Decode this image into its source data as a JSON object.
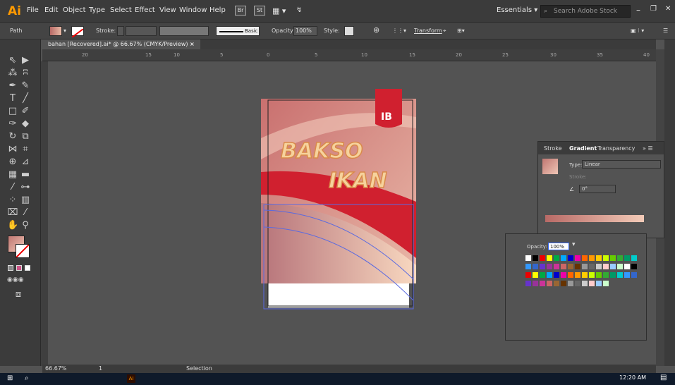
{
  "app": {
    "logo": "Ai"
  },
  "menu": [
    "File",
    "Edit",
    "Object",
    "Type",
    "Select",
    "Effect",
    "View",
    "Window",
    "Help"
  ],
  "badges": [
    "Br",
    "St"
  ],
  "workspace": "Essentials",
  "search_placeholder": "Search Adobe Stock",
  "control": {
    "selection": "Path",
    "stroke_label": "Stroke:",
    "brush": "Basic",
    "opacity_label": "Opacity:",
    "opacity_value": "100%",
    "style_label": "Style:",
    "transform_label": "Transform"
  },
  "document_tab": {
    "title": "bahan [Recovered].ai* @ 66.67% (CMYK/Preview)",
    "close": "×"
  },
  "ruler": [
    "20",
    "15",
    "10",
    "5",
    "0",
    "5",
    "10",
    "15",
    "20",
    "25",
    "30",
    "35",
    "40"
  ],
  "artwork": {
    "tag": "IB",
    "line1": "BAKSO",
    "line2": "IKAN"
  },
  "gradient_panel": {
    "tabs": [
      "Stroke",
      "Gradient",
      "Transparency"
    ],
    "type_label": "Type:",
    "type_value": "Linear",
    "stroke_label": "Stroke:",
    "angle": "0°"
  },
  "swatch_panel": {
    "opacity_label": "Opacity:",
    "opacity_value": "100%"
  },
  "status": {
    "zoom": "66.67%",
    "artboard": "1",
    "mode": "Selection"
  },
  "taskbar": {
    "time": "12:20 AM"
  },
  "colors": {
    "accent": "#ff9a00",
    "art_red": "#d0202f"
  }
}
